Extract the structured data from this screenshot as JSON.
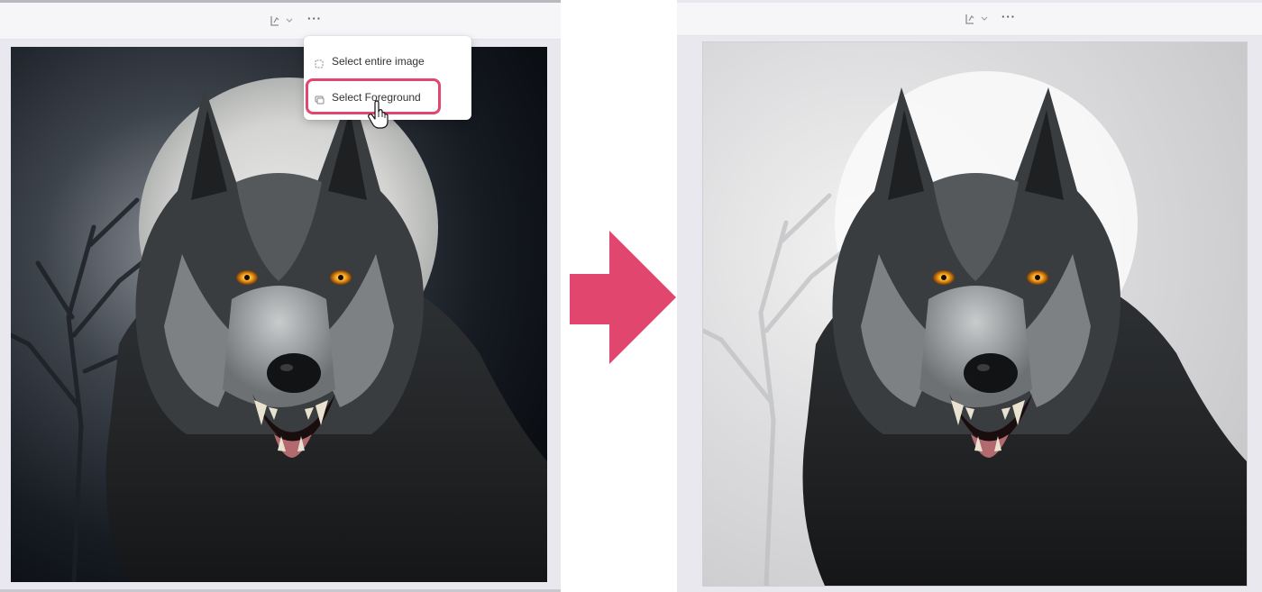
{
  "left_panel": {
    "toolbar": {
      "icon": "ai-select-icon",
      "chevron": "chevron-down-icon",
      "more_label": "···"
    },
    "menu": {
      "items": [
        {
          "label": "Select entire image",
          "icon": "select-all-icon"
        },
        {
          "label": "Select Foreground",
          "icon": "foreground-icon"
        }
      ],
      "highlighted_item": "Select Foreground"
    }
  },
  "right_panel": {
    "toolbar": {
      "icon": "ai-select-icon",
      "chevron": "chevron-down-icon",
      "more_label": "···"
    }
  },
  "colors": {
    "accent": "#e0466e",
    "panel_bg": "#e9e8ee",
    "toolbar_bg": "#f6f6f9"
  }
}
